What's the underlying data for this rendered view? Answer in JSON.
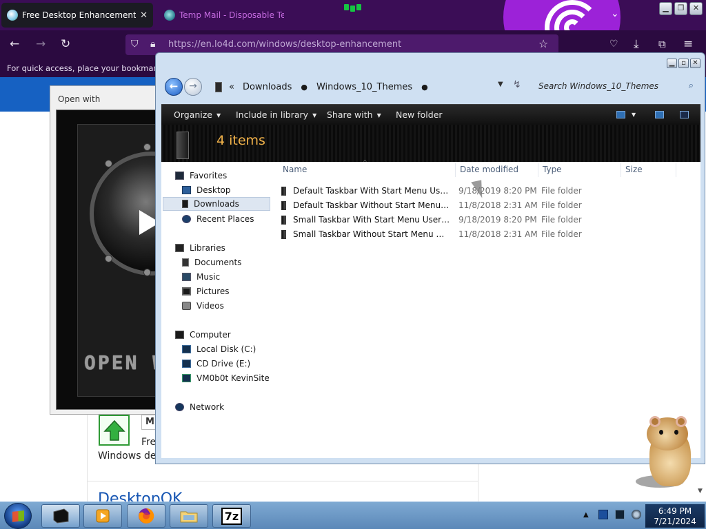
{
  "browser": {
    "tabs": [
      {
        "title": "Free Desktop Enhancement Soft",
        "active": true
      },
      {
        "title": "Temp Mail - Disposable Tempor",
        "active": false
      }
    ],
    "url": "https://en.lo4d.com/windows/desktop-enhancement",
    "bookmark_hint": "For quick access, place your bookmarks h"
  },
  "webpage": {
    "m_label": "M",
    "text_free": "Fre",
    "text_windows": "Windows de",
    "link_desktopok": "DesktopOK"
  },
  "open_with": {
    "title": "Open with",
    "caption": "OPEN W"
  },
  "explorer": {
    "breadcrumb": [
      "Downloads",
      "Windows_10_Themes"
    ],
    "search_placeholder": "Search Windows_10_Themes",
    "toolbar": {
      "organize": "Organize",
      "include_in_library": "Include in library",
      "share_with": "Share with",
      "new_folder": "New folder"
    },
    "item_count": "4 items",
    "columns": {
      "name": "Name",
      "date_modified": "Date modified",
      "type": "Type",
      "size": "Size"
    },
    "nav": {
      "favorites": "Favorites",
      "desktop": "Desktop",
      "downloads": "Downloads",
      "recent_places": "Recent Places",
      "libraries": "Libraries",
      "documents": "Documents",
      "music": "Music",
      "pictures": "Pictures",
      "videos": "Videos",
      "computer": "Computer",
      "local_disk": "Local Disk (C:)",
      "cd_drive": "CD Drive (E:)",
      "network_share": "VM0b0t KevinSite",
      "network": "Network"
    },
    "files": [
      {
        "name": "Default Taskbar With Start Menu User Pic...",
        "date": "9/18/2019 8:20 PM",
        "type": "File folder"
      },
      {
        "name": "Default Taskbar Without Start Menu User...",
        "date": "11/8/2018 2:31 AM",
        "type": "File folder"
      },
      {
        "name": "Small Taskbar With Start Menu User Pict...",
        "date": "9/18/2019 8:20 PM",
        "type": "File folder"
      },
      {
        "name": "Small Taskbar Without Start Menu User P...",
        "date": "11/8/2018 2:31 AM",
        "type": "File folder"
      }
    ]
  },
  "taskbar": {
    "time": "6:49 PM",
    "date": "7/21/2024",
    "seven_zip_label": "7z"
  },
  "colors": {
    "browser_tabbar": "#3b0d56",
    "browser_toolbar": "#2b0a40",
    "page_accent": "#1661c2",
    "explorer_frame": "#cfe0f2",
    "item_count_color": "#f1b24a"
  }
}
